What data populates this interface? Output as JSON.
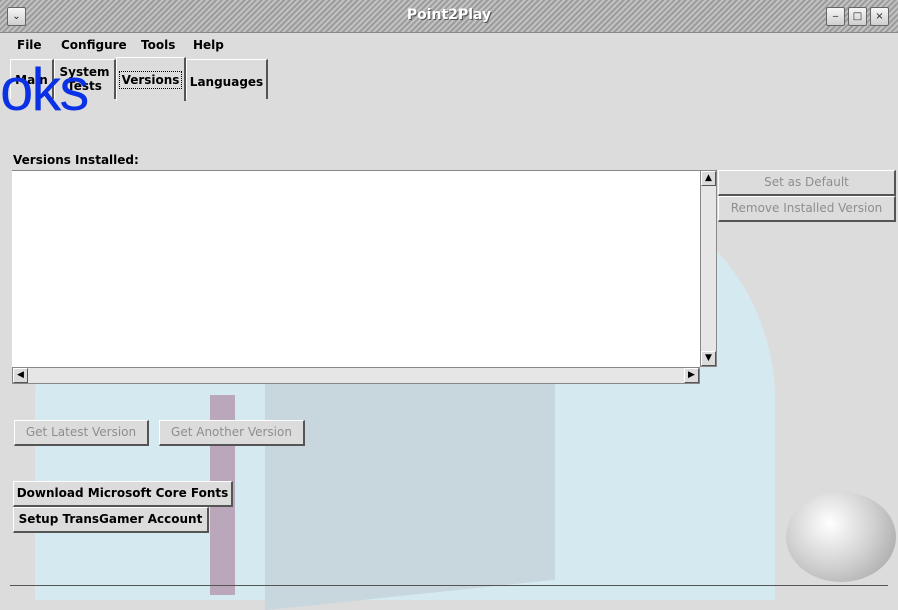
{
  "window": {
    "title": "Point2Play",
    "menu_icon": "chevron-down-icon",
    "controls": [
      "minimize-icon",
      "maximize-icon",
      "close-icon"
    ]
  },
  "menubar": {
    "items": [
      "File",
      "Configure",
      "Tools",
      "Help"
    ]
  },
  "tabs": {
    "main": "Main",
    "system_tests_line1": "System",
    "system_tests_line2": "Tests",
    "versions": "Versions",
    "languages": "Languages",
    "active": "Versions"
  },
  "watermark_logo": "oks",
  "versions": {
    "installed_label": "Versions Installed:",
    "items": [],
    "set_default": "Set as Default",
    "remove_installed": "Remove Installed Version",
    "get_latest": "Get Latest Version",
    "get_another": "Get Another Version",
    "download_fonts": "Download Microsoft Core Fonts",
    "setup_account": "Setup TransGamer Account"
  },
  "colors": {
    "logo_blue": "#0a31e6",
    "background": "#dcdcdc",
    "watermark": "#d5eaf0"
  }
}
